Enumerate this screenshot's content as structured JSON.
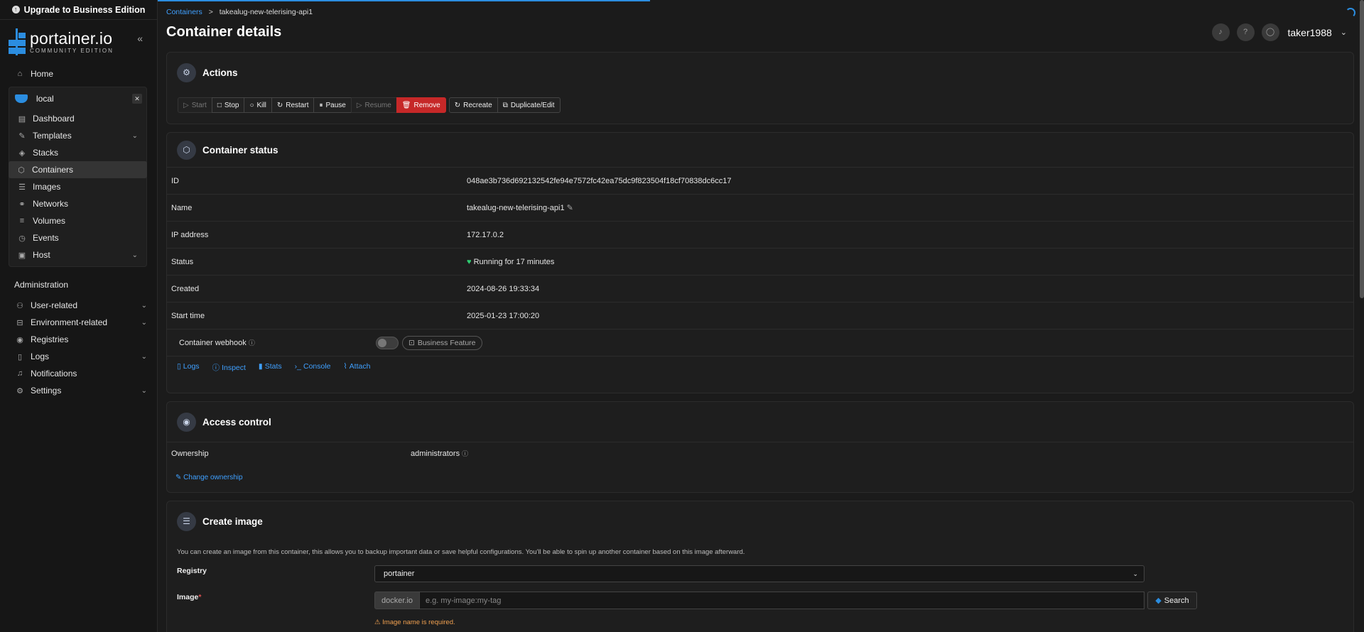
{
  "sidebar": {
    "upgrade_label": "Upgrade to Business Edition",
    "brand_name": "portainer.io",
    "brand_edition": "COMMUNITY EDITION",
    "home": "Home",
    "environment": "local",
    "env_items": [
      {
        "label": "Dashboard",
        "icon": "dashboard-icon"
      },
      {
        "label": "Templates",
        "icon": "edit-icon",
        "chevron": true
      },
      {
        "label": "Stacks",
        "icon": "layers-icon"
      },
      {
        "label": "Containers",
        "icon": "box-icon",
        "active": true
      },
      {
        "label": "Images",
        "icon": "list-icon"
      },
      {
        "label": "Networks",
        "icon": "network-icon"
      },
      {
        "label": "Volumes",
        "icon": "database-icon"
      },
      {
        "label": "Events",
        "icon": "clock-icon"
      },
      {
        "label": "Host",
        "icon": "server-icon",
        "chevron": true
      }
    ],
    "admin_title": "Administration",
    "admin_items": [
      {
        "label": "User-related",
        "chevron": true
      },
      {
        "label": "Environment-related",
        "chevron": true
      },
      {
        "label": "Registries"
      },
      {
        "label": "Logs",
        "chevron": true
      },
      {
        "label": "Notifications"
      },
      {
        "label": "Settings",
        "chevron": true
      }
    ]
  },
  "header": {
    "breadcrumb_link": "Containers",
    "breadcrumb_sep": ">",
    "breadcrumb_current": "takealug-new-telerising-api1",
    "title": "Container details",
    "username": "taker1988"
  },
  "actions": {
    "title": "Actions",
    "start": "Start",
    "stop": "Stop",
    "kill": "Kill",
    "restart": "Restart",
    "pause": "Pause",
    "resume": "Resume",
    "remove": "Remove",
    "recreate": "Recreate",
    "duplicate": "Duplicate/Edit"
  },
  "status": {
    "title": "Container status",
    "rows": [
      {
        "key": "ID",
        "value": "048ae3b736d692132542fe94e7572fc42ea75dc9f823504f18cf70838dc6cc17"
      },
      {
        "key": "Name",
        "value": "takealug-new-telerising-api1"
      },
      {
        "key": "IP address",
        "value": "172.17.0.2"
      },
      {
        "key": "Status",
        "value": "Running for 17 minutes"
      },
      {
        "key": "Created",
        "value": "2024-08-26 19:33:34"
      },
      {
        "key": "Start time",
        "value": "2025-01-23 17:00:20"
      }
    ],
    "webhook_label": "Container webhook",
    "business_feature": "Business Feature",
    "links": {
      "logs": "Logs",
      "inspect": "Inspect",
      "stats": "Stats",
      "console": "Console",
      "attach": "Attach"
    }
  },
  "access": {
    "title": "Access control",
    "ownership_label": "Ownership",
    "ownership_value": "administrators",
    "change_link": "Change ownership"
  },
  "create_image": {
    "title": "Create image",
    "description": "You can create an image from this container, this allows you to backup important data or save helpful configurations. You'll be able to spin up another container based on this image afterward.",
    "registry_label": "Registry",
    "registry_value": "portainer",
    "image_label": "Image",
    "image_prefix": "docker.io",
    "image_placeholder": "e.g. my-image:my-tag",
    "search_label": "Search",
    "warning": "Image name is required."
  },
  "colors": {
    "accent": "#2b8de0",
    "danger": "#c62828",
    "running": "#2ecc71",
    "warning": "#f0a050"
  }
}
